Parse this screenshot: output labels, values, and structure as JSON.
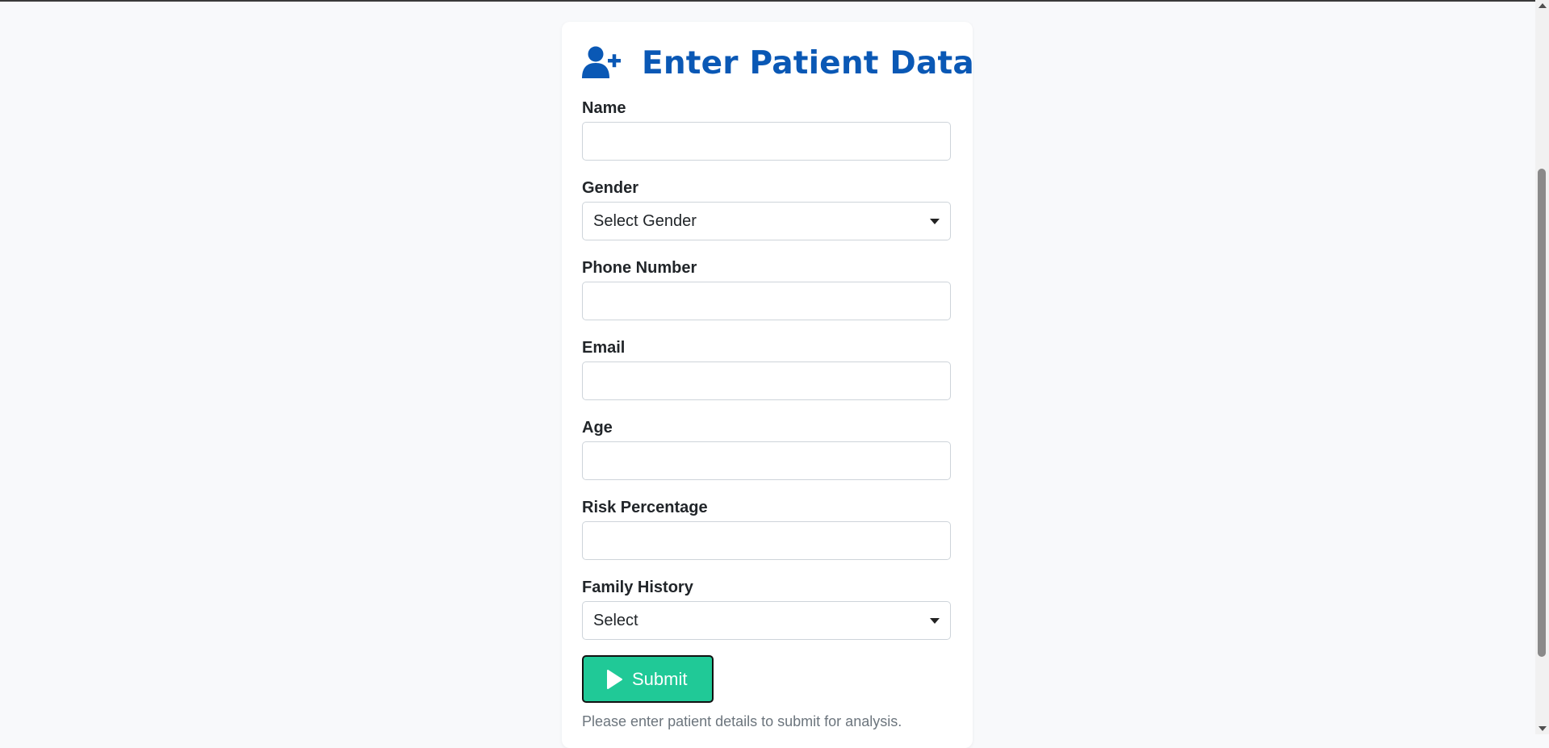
{
  "form": {
    "title": "Enter Patient Data",
    "title_icon": "user-plus-icon",
    "fields": {
      "name": {
        "label": "Name",
        "value": ""
      },
      "gender": {
        "label": "Gender",
        "selected": "Select Gender"
      },
      "phone": {
        "label": "Phone Number",
        "value": ""
      },
      "email": {
        "label": "Email",
        "value": ""
      },
      "age": {
        "label": "Age",
        "value": ""
      },
      "risk": {
        "label": "Risk Percentage",
        "value": ""
      },
      "family_history": {
        "label": "Family History",
        "selected": "Select"
      }
    },
    "submit_label": "Submit",
    "submit_icon": "play-icon",
    "hint": "Please enter patient details to submit for analysis."
  },
  "colors": {
    "accent": "#0a58b5",
    "submit_bg": "#20c997",
    "page_bg": "#f8f9fb"
  }
}
